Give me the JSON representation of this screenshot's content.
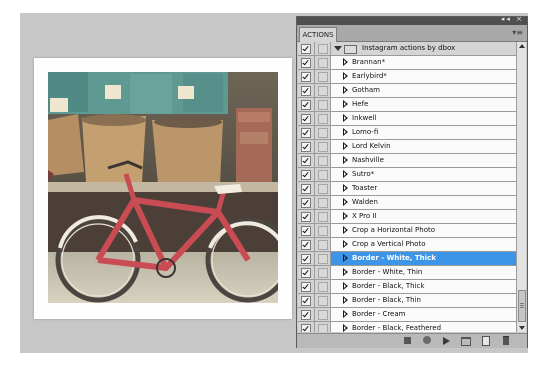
{
  "panel": {
    "tab_label": "ACTIONS",
    "window_controls": "◂◂ ×",
    "menu_icon": "panel-menu-icon"
  },
  "actions": {
    "set_name": "Instagram actions by dbox",
    "items": [
      {
        "label": "Brannan*",
        "selected": false
      },
      {
        "label": "Earlybird*",
        "selected": false
      },
      {
        "label": "Gotham",
        "selected": false
      },
      {
        "label": "Hefe",
        "selected": false
      },
      {
        "label": "Inkwell",
        "selected": false
      },
      {
        "label": "Lomo-fi",
        "selected": false
      },
      {
        "label": "Lord Kelvin",
        "selected": false
      },
      {
        "label": "Nashville",
        "selected": false
      },
      {
        "label": "Sutro*",
        "selected": false
      },
      {
        "label": "Toaster",
        "selected": false
      },
      {
        "label": "Walden",
        "selected": false
      },
      {
        "label": "X Pro II",
        "selected": false
      },
      {
        "label": "Crop a Horizontal Photo",
        "selected": false
      },
      {
        "label": "Crop a Vertical Photo",
        "selected": false
      },
      {
        "label": "Border - White, Thick",
        "selected": true
      },
      {
        "label": "Border - White, Thin",
        "selected": false
      },
      {
        "label": "Border - Black, Thick",
        "selected": false
      },
      {
        "label": "Border - Black, Thin",
        "selected": false
      },
      {
        "label": "Border - Cream",
        "selected": false
      },
      {
        "label": "Border - Black, Feathered",
        "selected": false
      }
    ]
  },
  "bottom_toolbar": [
    "stop-icon",
    "record-icon",
    "play-icon",
    "new-set-icon",
    "new-action-icon",
    "trash-icon"
  ],
  "colors": {
    "selection": "#3d95e8",
    "panel_bg": "#c8c8c8",
    "canvas_bg": "#c7c7c7"
  }
}
